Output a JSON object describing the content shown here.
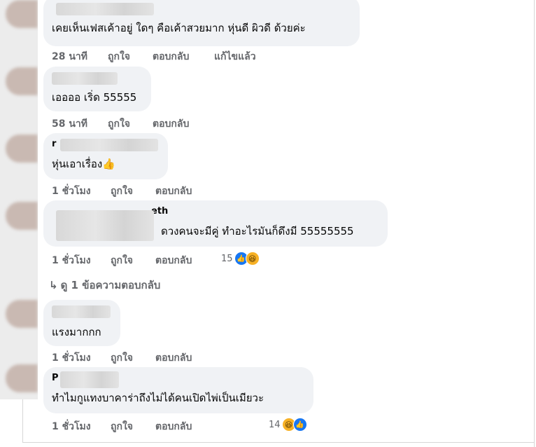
{
  "comments": [
    {
      "name_fragment": "",
      "text": "เคยเห็นเฟสเค้าอยู่ ใดๆ คือเค้าสวยมาก หุ่นดี ผิวดี ด้วยค่ะ",
      "time": "28 นาที",
      "like_label": "ถูกใจ",
      "reply_label": "ตอบกลับ",
      "edited_label": "แก้ไขแล้ว"
    },
    {
      "name_fragment": "",
      "text": "เออออ เริ่ด 55555",
      "time": "58 นาที",
      "like_label": "ถูกใจ",
      "reply_label": "ตอบกลับ"
    },
    {
      "name_fragment": "r",
      "text": "หุ่นเอาเรื่อง👍",
      "time": "1 ชั่วโมง",
      "like_label": "ถูกใจ",
      "reply_label": "ตอบกลับ"
    },
    {
      "name_fragment": "eth",
      "text": "ดวงคนจะมีคู่ ทำอะไรมันก็ดึงมี 55555555",
      "time": "1 ชั่วโมง",
      "like_label": "ถูกใจ",
      "reply_label": "ตอบกลับ",
      "reaction_count": "15",
      "reactions": [
        "like-icon",
        "haha-icon"
      ]
    },
    {
      "name_fragment": "",
      "text": "แรงมากกก",
      "time": "1 ชั่วโมง",
      "like_label": "ถูกใจ",
      "reply_label": "ตอบกลับ"
    },
    {
      "name_fragment": "P",
      "text": "ทำไมกูแทงบาคาร่าถึงไม่ได้คนเปิดไพ่เป็นเมียวะ",
      "time": "1 ชั่วโมง",
      "like_label": "ถูกใจ",
      "reply_label": "ตอบกลับ",
      "reaction_count": "14",
      "reactions": [
        "haha-icon",
        "like-icon"
      ]
    }
  ],
  "view_replies": "ดู 1 ข้อความตอบกลับ",
  "colors": {
    "bubble": "#f0f2f5",
    "meta_text": "#65676b",
    "like_blue": "#1877f2",
    "haha_yellow": "#f7b125"
  }
}
